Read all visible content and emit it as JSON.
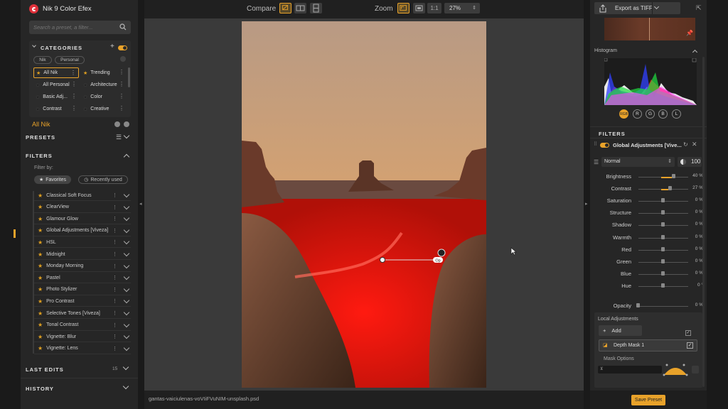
{
  "app": {
    "title": "Nik 9 Color Efex"
  },
  "search": {
    "placeholder": "Search a preset, a filter..."
  },
  "categories": {
    "heading": "CATEGORIES",
    "pills": [
      "Nik",
      "Personal"
    ],
    "items": [
      {
        "label": "All Nik",
        "starred": true,
        "selected": true
      },
      {
        "label": "Trending",
        "starred": true
      },
      {
        "label": "All Personal",
        "starred": false
      },
      {
        "label": "Architecture",
        "starred": false
      },
      {
        "label": "Basic Adj...",
        "starred": false
      },
      {
        "label": "Color",
        "starred": false
      },
      {
        "label": "Contrast",
        "starred": false
      },
      {
        "label": "Creative",
        "starred": false
      }
    ],
    "current": "All Nik"
  },
  "presets": {
    "heading": "PRESETS"
  },
  "filters": {
    "heading": "FILTERS",
    "filter_by_label": "Filter by:",
    "favorites_label": "Favorites",
    "recently_used_label": "Recently used",
    "items": [
      "Classical Soft Focus",
      "ClearView",
      "Glamour Glow",
      "Global Adjustments [Viveza]",
      "HSL",
      "Midnight",
      "Monday Morning",
      "Pastel",
      "Photo Stylizer",
      "Pro Contrast",
      "Selective Tones [Viveza]",
      "Tonal Contrast",
      "Vignette: Blur",
      "Vignette: Lens"
    ]
  },
  "last_edits": {
    "heading": "LAST EDITS",
    "count": "15"
  },
  "history": {
    "heading": "HISTORY"
  },
  "toolbar": {
    "compare_label": "Compare",
    "zoom_label": "Zoom",
    "zoom_ratio": "1:1",
    "zoom_value": "27%"
  },
  "canvas": {
    "filename": "gantas-vaiciulenas-voVIiFVuNIM-unsplash.psd",
    "control_point_label": "Op"
  },
  "right": {
    "export_label": "Export as TIFF",
    "histogram_heading": "Histogram",
    "histogram_buttons": [
      "RGB",
      "R",
      "G",
      "B",
      "L"
    ],
    "filters_heading": "FILTERS",
    "filter_title": "Global Adjustments [Vive...",
    "blend_mode": "Normal",
    "opacity_value": "100",
    "sliders": [
      {
        "label": "Brightness",
        "value": "40 %",
        "amount": 40
      },
      {
        "label": "Contrast",
        "value": "27 %",
        "amount": 27
      },
      {
        "label": "Saturation",
        "value": "0 %",
        "amount": 0
      },
      {
        "label": "Structure",
        "value": "0 %",
        "amount": 0
      },
      {
        "label": "Shadow",
        "value": "0 %",
        "amount": 0
      },
      {
        "label": "Warmth",
        "value": "0 %",
        "amount": 0
      },
      {
        "label": "Red",
        "value": "0 %",
        "amount": 0
      },
      {
        "label": "Green",
        "value": "0 %",
        "amount": 0
      },
      {
        "label": "Blue",
        "value": "0 %",
        "amount": 0
      },
      {
        "label": "Hue",
        "value": "0 °",
        "amount": 0
      }
    ],
    "opacity_slider": {
      "label": "Opacity",
      "value": "0 %"
    },
    "local_adjustments_heading": "Local Adjustments",
    "add_label": "Add",
    "mask_name": "Depth Mask 1",
    "mask_options_label": "Mask Options",
    "save_preset_label": "Save Preset"
  },
  "colors": {
    "accent": "#e8a22a",
    "brand": "#e0303a",
    "mask_red": "#e01010"
  }
}
